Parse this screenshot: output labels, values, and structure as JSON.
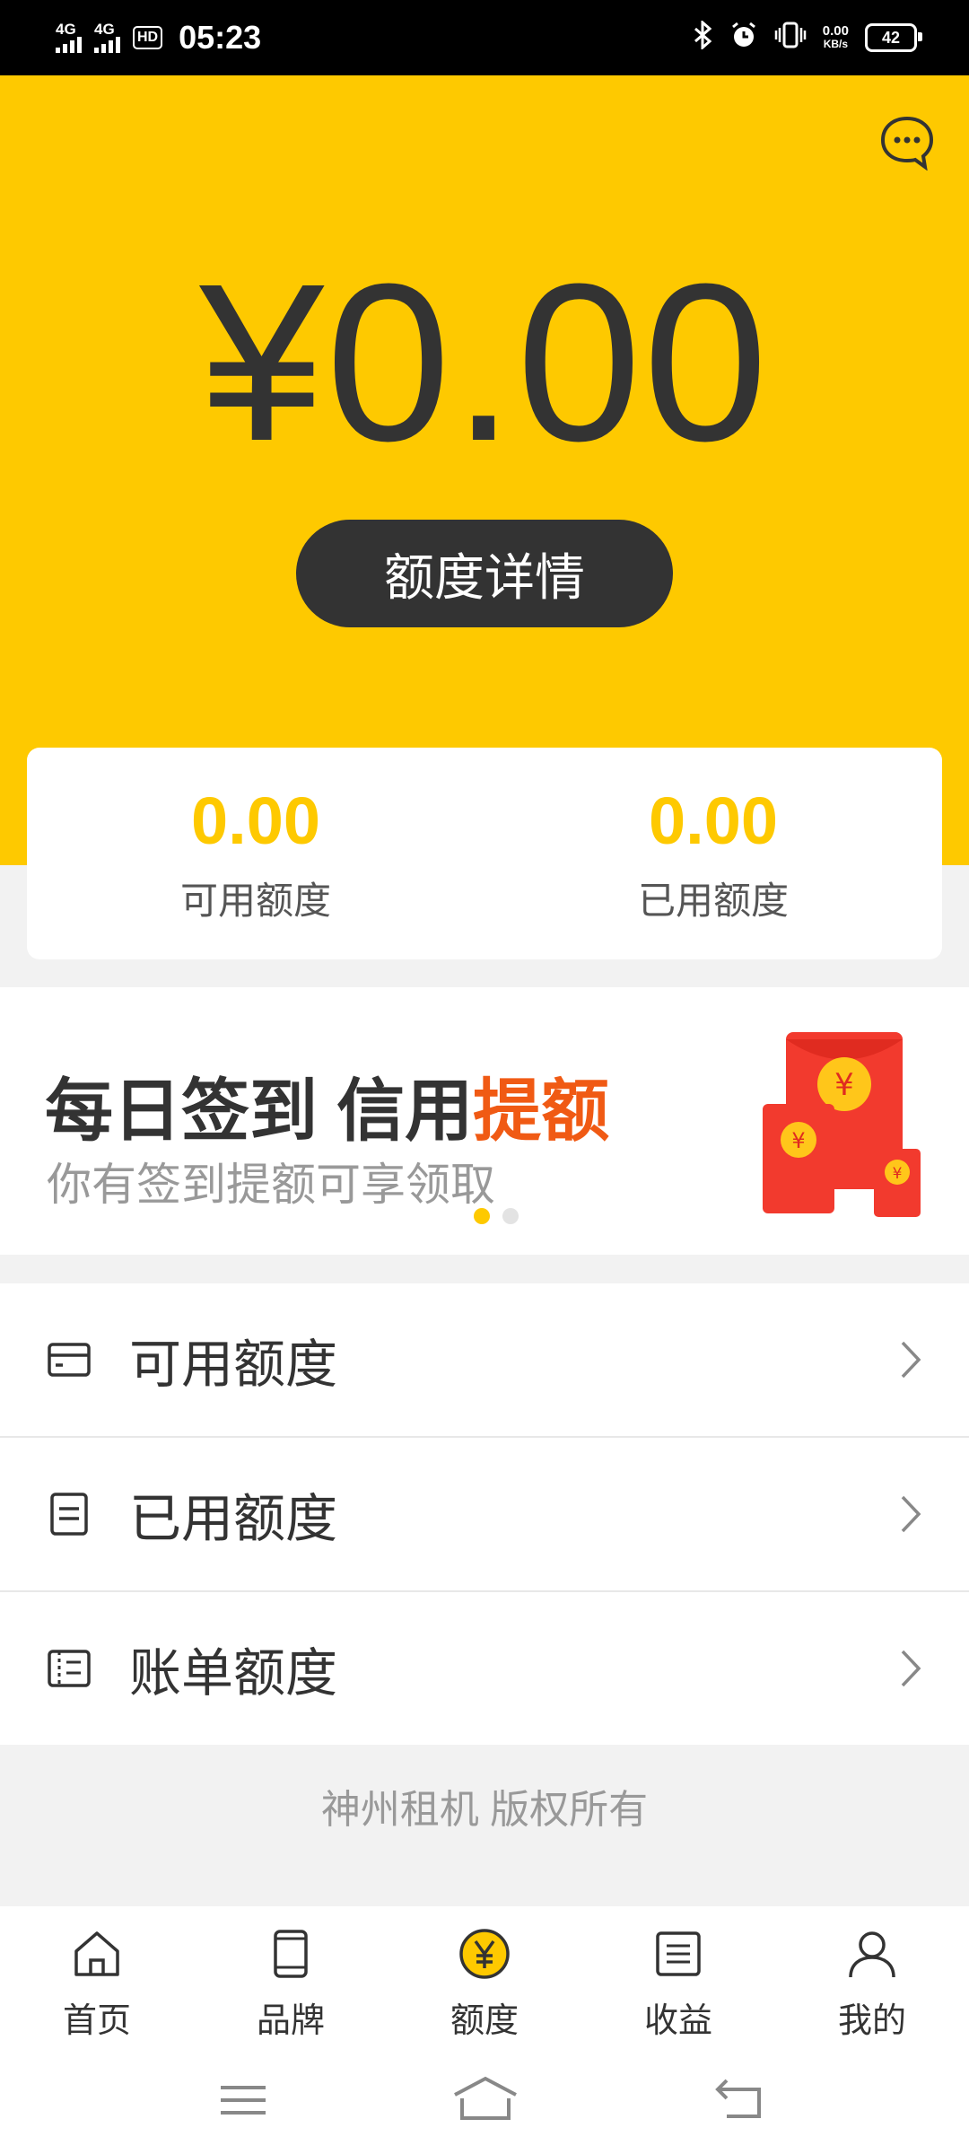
{
  "status_bar": {
    "net1": "4G",
    "net2": "4G",
    "hd": "HD",
    "time": "05:23",
    "speed_value": "0.00",
    "speed_unit": "KB/s",
    "battery": "42"
  },
  "hero": {
    "amount": "¥0.00",
    "detail_button": "额度详情"
  },
  "stats": [
    {
      "value": "0.00",
      "label": "可用额度"
    },
    {
      "value": "0.00",
      "label": "已用额度"
    }
  ],
  "banner": {
    "title_main": "每日签到 信用",
    "title_highlight": "提额",
    "subtitle": "你有签到提额可享领取"
  },
  "menu": [
    {
      "label": "可用额度",
      "icon": "card-icon"
    },
    {
      "label": "已用额度",
      "icon": "document-icon"
    },
    {
      "label": "账单额度",
      "icon": "bill-icon"
    }
  ],
  "footer": {
    "copyright": "神州租机 版权所有"
  },
  "tabs": [
    {
      "label": "首页",
      "icon": "home-icon"
    },
    {
      "label": "品牌",
      "icon": "phone-icon"
    },
    {
      "label": "额度",
      "icon": "yen-icon",
      "active": true
    },
    {
      "label": "收益",
      "icon": "list-icon"
    },
    {
      "label": "我的",
      "icon": "user-icon"
    }
  ],
  "colors": {
    "accent": "#fec900",
    "highlight": "#f05a14",
    "dark": "#333333"
  }
}
